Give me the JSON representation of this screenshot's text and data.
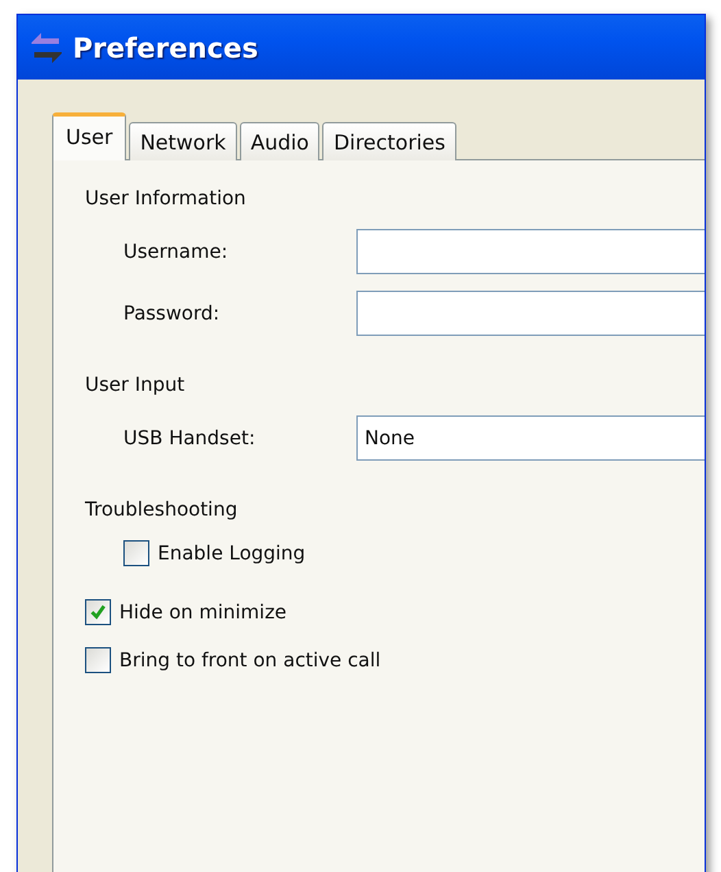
{
  "window": {
    "title": "Preferences"
  },
  "tabs": [
    {
      "label": "User",
      "selected": true
    },
    {
      "label": "Network",
      "selected": false
    },
    {
      "label": "Audio",
      "selected": false
    },
    {
      "label": "Directories",
      "selected": false
    }
  ],
  "sections": [
    {
      "heading": "User Information",
      "fields": [
        {
          "kind": "text",
          "label": "Username:"
        },
        {
          "kind": "password",
          "label": "Password:"
        }
      ]
    },
    {
      "heading": "User Input",
      "fields": [
        {
          "kind": "dropdown",
          "label": "USB Handset:",
          "value": "None"
        }
      ]
    },
    {
      "heading": "Troubleshooting",
      "checkboxes": [
        {
          "label": "Enable Logging",
          "checked": false
        }
      ]
    }
  ],
  "options": [
    {
      "label": "Hide on minimize",
      "checked": true
    },
    {
      "label": "Bring to front on active call",
      "checked": false
    }
  ]
}
